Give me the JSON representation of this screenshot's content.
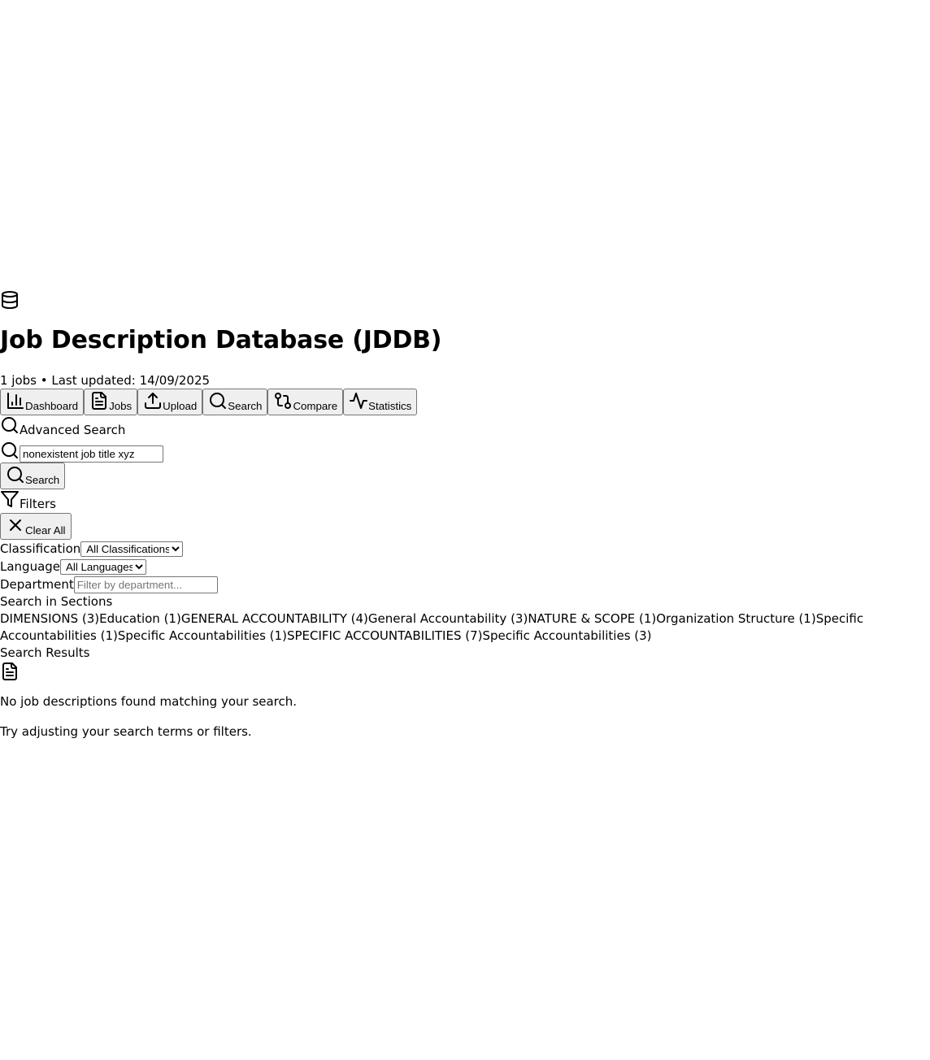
{
  "header": {
    "title": "Job Description Database (JDDB)",
    "meta": "1 jobs • Last updated: 14/09/2025",
    "logo_icon": "database-icon"
  },
  "nav": {
    "items": [
      {
        "label": "Dashboard",
        "icon": "bar-chart-icon"
      },
      {
        "label": "Jobs",
        "icon": "file-text-icon"
      },
      {
        "label": "Upload",
        "icon": "upload-icon"
      },
      {
        "label": "Search",
        "icon": "search-icon"
      },
      {
        "label": "Compare",
        "icon": "git-compare-icon"
      },
      {
        "label": "Statistics",
        "icon": "activity-icon"
      }
    ]
  },
  "advanced_search": {
    "heading": "Advanced Search",
    "query_value": "nonexistent job title xyz",
    "search_button": "Search"
  },
  "filters": {
    "heading": "Filters",
    "clear_all": "Clear All",
    "classification_label": "Classification",
    "classification_value": "All Classifications",
    "language_label": "Language",
    "language_value": "All Languages",
    "department_label": "Department",
    "department_placeholder": "Filter by department..."
  },
  "sections": {
    "label": "Search in Sections",
    "items": [
      "DIMENSIONS (3)",
      "Education (1)",
      "GENERAL ACCOUNTABILITY (4)",
      "General Accountability (3)",
      "NATURE & SCOPE (1)",
      "Organization Structure (1)",
      "Specific Accountabilities (1)",
      "Specific Accountabilities (1)",
      "SPECIFIC ACCOUNTABILITIES (7)",
      "Specific Accountabilities (3)"
    ]
  },
  "results": {
    "label": "Search Results",
    "empty_message": "No job descriptions found matching your search.",
    "empty_hint": "Try adjusting your search terms or filters."
  }
}
